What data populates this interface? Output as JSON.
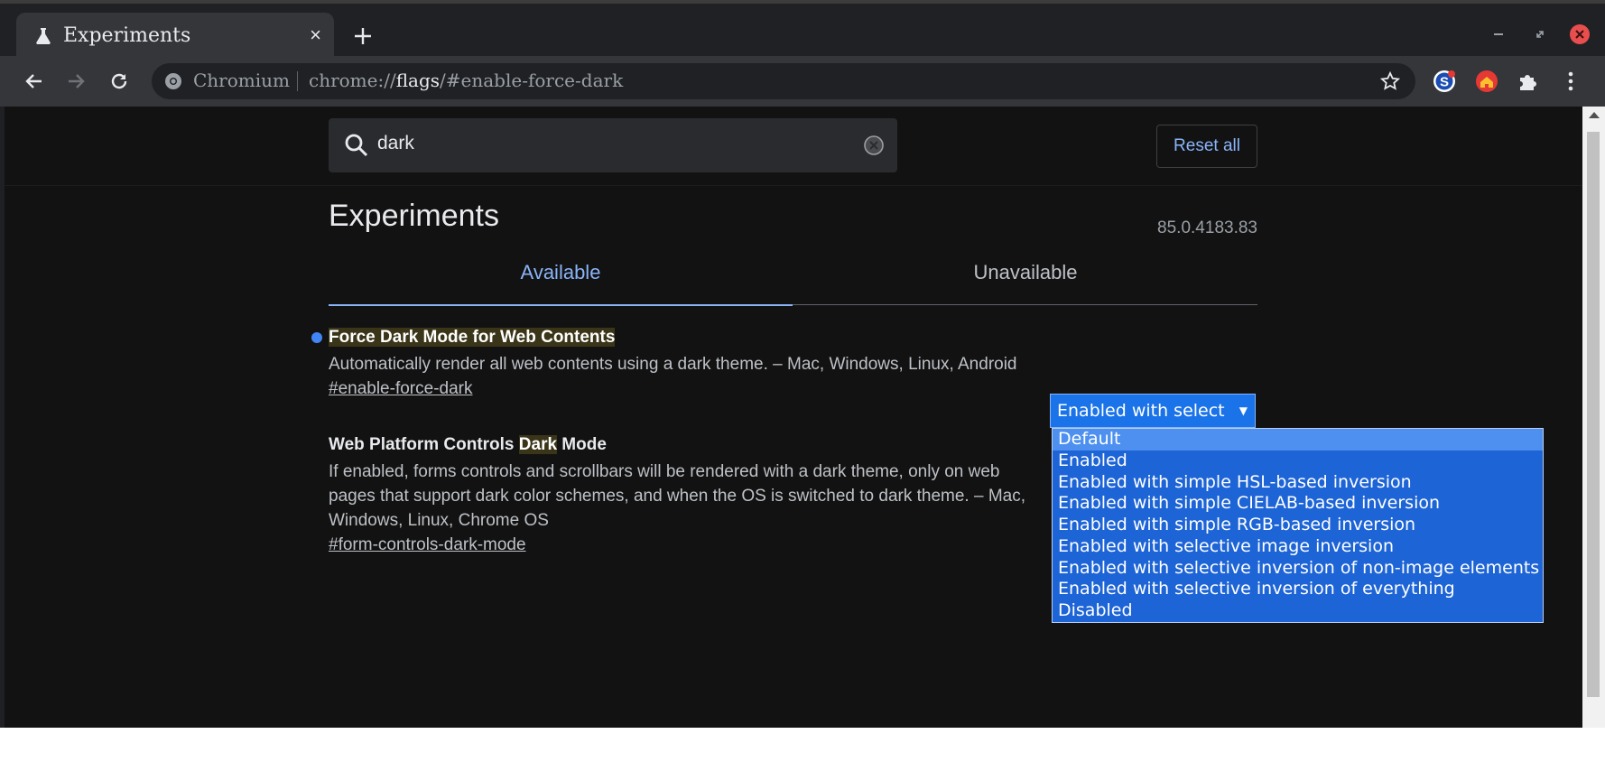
{
  "tab": {
    "title": "Experiments",
    "close_glyph": "×",
    "icon": "flask-icon"
  },
  "toolbar": {
    "site_chip": "Chromium",
    "url_scheme": "chrome://",
    "url_host": "flags",
    "url_path": "/#enable-force-dark"
  },
  "search": {
    "query": "dark"
  },
  "reset_all_label": "Reset all",
  "heading": "Experiments",
  "version": "85.0.4183.83",
  "tabs": {
    "available": "Available",
    "unavailable": "Unavailable"
  },
  "flags": [
    {
      "title_before": "Force ",
      "title_match": "Dark",
      "title_after": " Mode for Web Contents",
      "description": "Automatically render all web contents using a dark theme. – Mac, Windows, Linux, Android",
      "link": "#enable-force-dark",
      "selected_value": "Enabled with select",
      "modified": true
    },
    {
      "title_before": "Web Platform Controls ",
      "title_match": "Dark",
      "title_after": " Mode",
      "description": "If enabled, forms controls and scrollbars will be rendered with a dark theme, only on web pages that support dark color schemes, and when the OS is switched to dark theme. – Mac, Windows, Linux, Chrome OS",
      "link": "#form-controls-dark-mode"
    }
  ],
  "dropdown_options": [
    "Default",
    "Enabled",
    "Enabled with simple HSL-based inversion",
    "Enabled with simple CIELAB-based inversion",
    "Enabled with simple RGB-based inversion",
    "Enabled with selective image inversion",
    "Enabled with selective inversion of non-image elements",
    "Enabled with selective inversion of everything",
    "Disabled"
  ],
  "dropdown_highlighted": "Default",
  "colors": {
    "accent": "#8ab4f8",
    "select_bg": "#1a73e8",
    "page_bg": "#121212",
    "chrome_bg": "#35363a"
  }
}
